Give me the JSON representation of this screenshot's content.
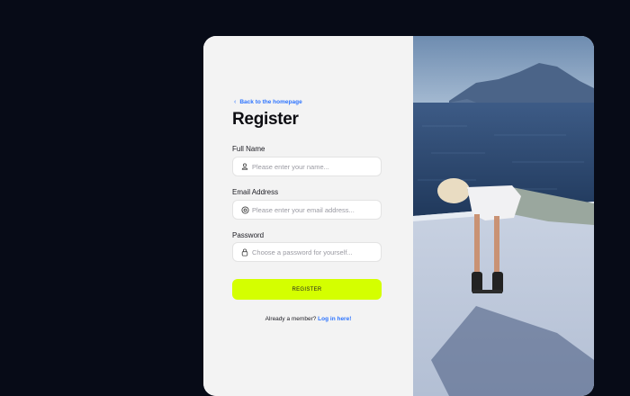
{
  "back_link": {
    "label": "Back to the homepage"
  },
  "form": {
    "title": "Register",
    "full_name": {
      "label": "Full Name",
      "placeholder": "Please enter your name...",
      "icon": "user-icon"
    },
    "email": {
      "label": "Email Address",
      "placeholder": "Please enter your email address...",
      "icon": "at-icon"
    },
    "password": {
      "label": "Password",
      "placeholder": "Choose a password for yourself...",
      "icon": "lock-icon"
    },
    "submit_label": "REGISTER"
  },
  "footer": {
    "prompt": "Already a member?",
    "link_label": "Log in here!"
  },
  "colors": {
    "accent": "#d4ff00",
    "link": "#2d74ff",
    "background": "#070b17",
    "panel": "#f3f3f3"
  },
  "photo": {
    "subject": "woman doing push-ups on dumbbells by the sea"
  }
}
